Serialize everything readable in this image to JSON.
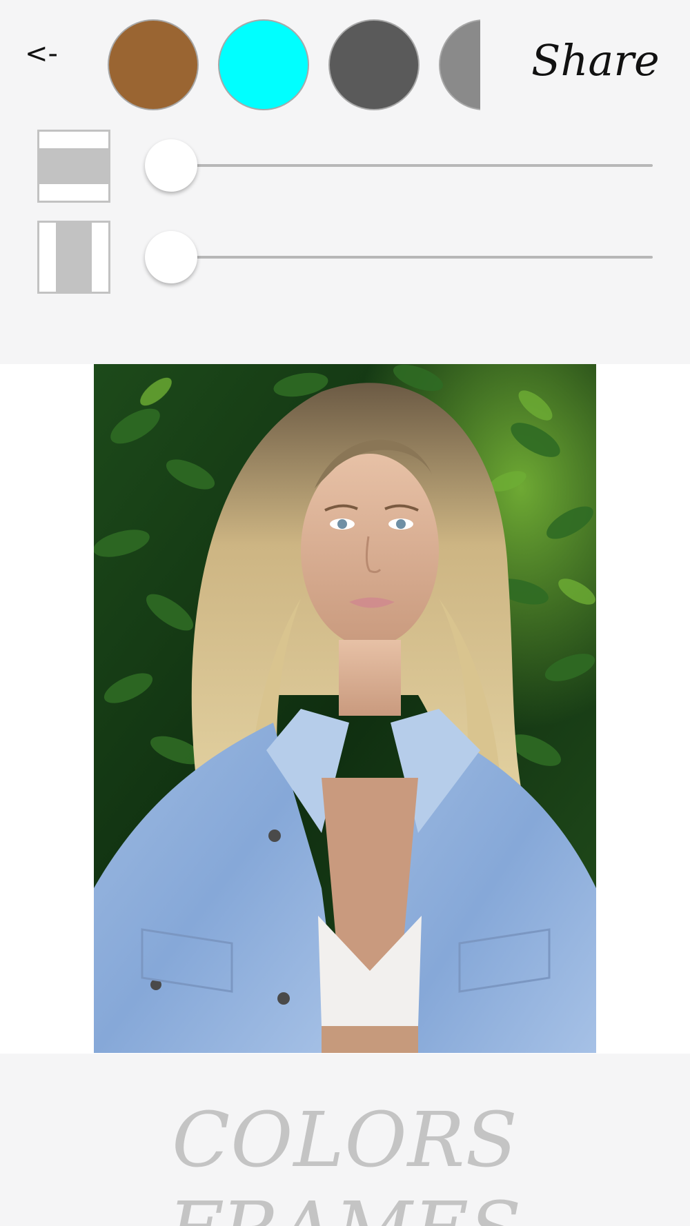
{
  "toolbar": {
    "back_label": "<-",
    "share_label": "Share"
  },
  "swatches": [
    {
      "color": "#9a6532",
      "name": "brown"
    },
    {
      "color": "#00ffff",
      "name": "cyan"
    },
    {
      "color": "#5a5a5a",
      "name": "dark-gray"
    },
    {
      "color": "#8a8a8a",
      "name": "gray"
    }
  ],
  "sliders": {
    "horizontal_border": {
      "icon": "horizontal-frame-icon",
      "value": 0.0
    },
    "vertical_border": {
      "icon": "vertical-frame-icon",
      "value": 0.0
    }
  },
  "preview": {
    "photo": "portrait-photo"
  },
  "footer": {
    "brand": "COLORS FRAMES"
  },
  "colors": {
    "panel_bg": "#f5f5f6",
    "slider_track": "#b7b7b7",
    "frame_icon": "#c2c2c2",
    "brand_text": "#c4c4c4"
  }
}
